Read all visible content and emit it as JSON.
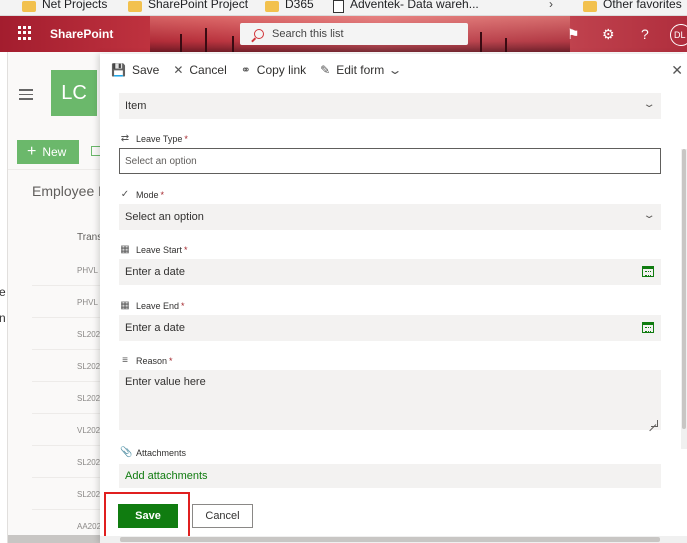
{
  "bookmarks": [
    {
      "label": "Net Projects",
      "icon": "folder-icon"
    },
    {
      "label": "SharePoint Project",
      "icon": "folder-icon"
    },
    {
      "label": "D365",
      "icon": "folder-icon"
    },
    {
      "label": "Adventek- Data wareh...",
      "icon": "page-icon"
    },
    {
      "label": "Other favorites",
      "icon": "folder-icon"
    }
  ],
  "header": {
    "brand": "SharePoint",
    "search_placeholder": "Search this list",
    "avatar": "DL",
    "icons": [
      "waffle-icon",
      "megaphone-icon",
      "gear-icon",
      "help-icon"
    ]
  },
  "background_page": {
    "site_initials": "LC",
    "new_label": "New",
    "list_title": "Employee L",
    "column_header": "Trans",
    "rows": [
      "PHVL",
      "PHVL",
      "SL202",
      "SL202",
      "SL202",
      "VL202",
      "SL202",
      "SL202",
      "AA202"
    ],
    "strip_fragments": [
      "e",
      "n"
    ]
  },
  "panel": {
    "commands": {
      "save": "Save",
      "cancel": "Cancel",
      "copy_link": "Copy link",
      "edit_form": "Edit form"
    },
    "content_type_value": "Item",
    "fields": {
      "leave_type": {
        "label": "Leave Type",
        "required": "*",
        "placeholder": "Select an option"
      },
      "mode": {
        "label": "Mode",
        "required": "*",
        "placeholder": "Select an option"
      },
      "leave_start": {
        "label": "Leave Start",
        "required": "*",
        "placeholder": "Enter a date"
      },
      "leave_end": {
        "label": "Leave End",
        "required": "*",
        "placeholder": "Enter a date"
      },
      "reason": {
        "label": "Reason",
        "required": "*",
        "placeholder": "Enter value here"
      },
      "attachments": {
        "label": "Attachments",
        "action": "Add attachments"
      }
    },
    "footer": {
      "save": "Save",
      "cancel": "Cancel"
    }
  },
  "colors": {
    "accent_green": "#107c10",
    "site_green": "#6bb86b",
    "highlight_red": "#e01f1f",
    "required_red": "#a4262c"
  }
}
